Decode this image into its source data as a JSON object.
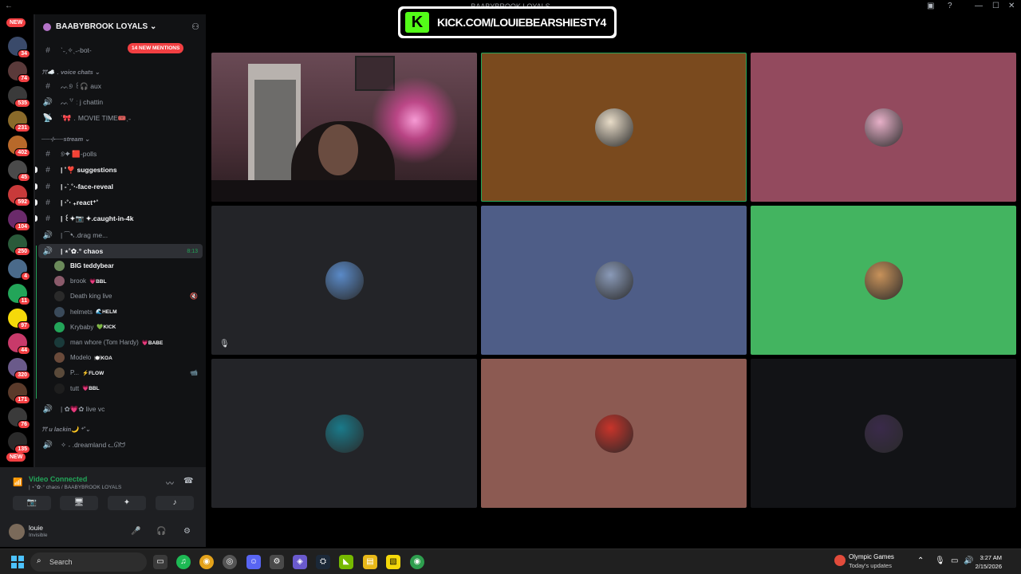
{
  "window": {
    "title": "BAABYBROOK LOYALS"
  },
  "server": {
    "name": "BAABYBROOK LOYALS ⌄"
  },
  "rail": {
    "new_label": "NEW",
    "badges": [
      "34",
      "74",
      "535",
      "231",
      "402",
      "45",
      "592",
      "104",
      "250",
      "4",
      "11",
      "97",
      "44",
      "320",
      "171",
      "76",
      "135"
    ]
  },
  "mentions_pill": "14 NEW MENTIONS",
  "channels": [
    {
      "name": "ˋ˗ˏ✧ˎ˗-bot-",
      "type": "text",
      "state": "normal"
    },
    {
      "name": "ꔫ☁️﹒voice chats ⌄",
      "type": "category"
    },
    {
      "name": "ᨓ୭ ꒰🎧 aux",
      "type": "text",
      "state": "normal"
    },
    {
      "name": "ᨓ꒷ ː j chattin",
      "type": "voice",
      "state": "muted"
    },
    {
      "name": "ˋ🎀﹒MOVIE TIME🎟️ˎ˗",
      "type": "stage",
      "state": "muted"
    },
    {
      "name": "──⊹──stream ⌄",
      "type": "category"
    },
    {
      "name": "୭✦ 🟥-polls",
      "type": "text",
      "state": "muted"
    },
    {
      "name": "| ˚❣️ suggestions",
      "type": "text",
      "state": "unread"
    },
    {
      "name": "| -ˋˏ˚‧-face-reveal",
      "type": "text",
      "state": "unread"
    },
    {
      "name": "| ‧˚‧ ₊react⁺˚",
      "type": "text",
      "state": "unread"
    },
    {
      "name": "| ꒰✦📷 ✦.caught-in-4k",
      "type": "text",
      "state": "unread"
    },
    {
      "name": "| ⁀➷.drag me...",
      "type": "voice",
      "state": "muted"
    },
    {
      "name": "| ⋆˚✿˖° chaos",
      "type": "voice",
      "state": "active",
      "timer": "8:13"
    },
    {
      "name": "| ✿💗✿ live vc",
      "type": "voice",
      "state": "muted"
    },
    {
      "name": "ꔫ u lackin🌙 ⁺˚⌄",
      "type": "category"
    },
    {
      "name": "✧ ˖ .dreamland ᓚᘏᗢ",
      "type": "voice",
      "state": "muted"
    }
  ],
  "voice_users": [
    {
      "name": "BIG teddybear",
      "tag": "",
      "avatar_color": "#6b8a5a",
      "bold": true
    },
    {
      "name": "brook",
      "tag": "💗BBL",
      "avatar_color": "#8a5a6a",
      "bold": false
    },
    {
      "name": "Death king live",
      "tag": "",
      "avatar_color": "#2a2a2a",
      "bold": false,
      "icon": "🔇"
    },
    {
      "name": "helmets",
      "tag": "🌊HELM",
      "avatar_color": "#3a4a5a",
      "bold": false
    },
    {
      "name": "Krybaby",
      "tag": "💚KICK",
      "avatar_color": "#23a559",
      "bold": false
    },
    {
      "name": "man whore (Tom Hardy)",
      "tag": "💗BABE",
      "avatar_color": "#1a3a3a",
      "bold": false
    },
    {
      "name": "Modelo",
      "tag": "🍽️KOA",
      "avatar_color": "#6a4a3a",
      "bold": false
    },
    {
      "name": "P...",
      "tag": "⚡FLOW",
      "avatar_color": "#5a4a3a",
      "bold": false,
      "icon": "📹"
    },
    {
      "name": "tutt",
      "tag": "💗BBL",
      "avatar_color": "#1e1e1e",
      "bold": false
    }
  ],
  "voice_panel": {
    "status": "Video Connected",
    "channel": "| ⋆˚✿˖° chaos / BAABYBROOK LOYALS"
  },
  "user": {
    "name": "louie",
    "status": "Invisible"
  },
  "kick_banner": {
    "logo": "K",
    "text": "KICK.COM/LOUIEBEARSHIESTY4"
  },
  "tiles": [
    {
      "type": "camera",
      "bg": "#4a3038"
    },
    {
      "type": "avatar",
      "bg": "#7a4a1e",
      "avatar_color": "#e8dcc8",
      "speaking": true
    },
    {
      "type": "avatar",
      "bg": "#934a5e",
      "avatar_color": "#e7b0c8"
    },
    {
      "type": "avatar",
      "bg": "#232428",
      "avatar_color": "#5a8ac8",
      "muted": true
    },
    {
      "type": "avatar",
      "bg": "#4e5d87",
      "avatar_color": "#8a9ab8"
    },
    {
      "type": "avatar",
      "bg": "#43b460",
      "avatar_color": "#c8925a"
    },
    {
      "type": "avatar",
      "bg": "#232428",
      "avatar_color": "#1a7a8a"
    },
    {
      "type": "avatar",
      "bg": "#8c5a52",
      "avatar_color": "#c8342a"
    },
    {
      "type": "avatar",
      "bg": "#121316",
      "avatar_color": "#3a2a4a"
    }
  ],
  "taskbar": {
    "search": "Search",
    "news_title": "Olympic Games",
    "news_sub": "Today's updates",
    "time": "3:27 AM",
    "date": "2/15/2026"
  }
}
